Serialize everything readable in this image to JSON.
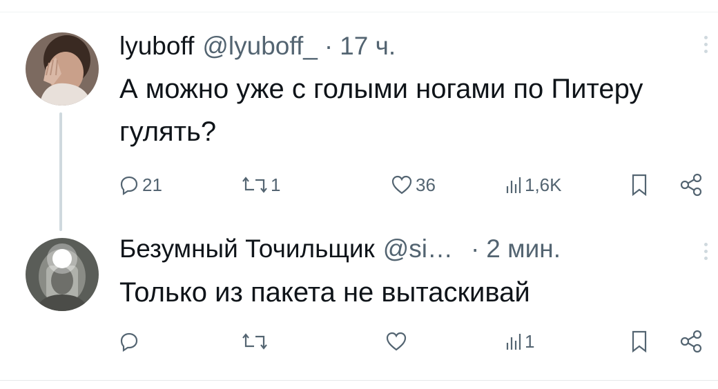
{
  "tweets": [
    {
      "name": "lyuboff",
      "handle": "@lyuboff_",
      "separator": "·",
      "time": "17 ч.",
      "text": "А можно уже с голыми ногами по Питеру гулять?",
      "replies": "21",
      "retweets": "1",
      "likes": "36",
      "views": "1,6K"
    },
    {
      "name": "Безумный Точильщик",
      "handle": "@si…",
      "separator": "·",
      "time": "2 мин.",
      "text": "Только из пакета не вытаскивай",
      "replies": "",
      "retweets": "",
      "likes": "",
      "views": "1"
    }
  ]
}
